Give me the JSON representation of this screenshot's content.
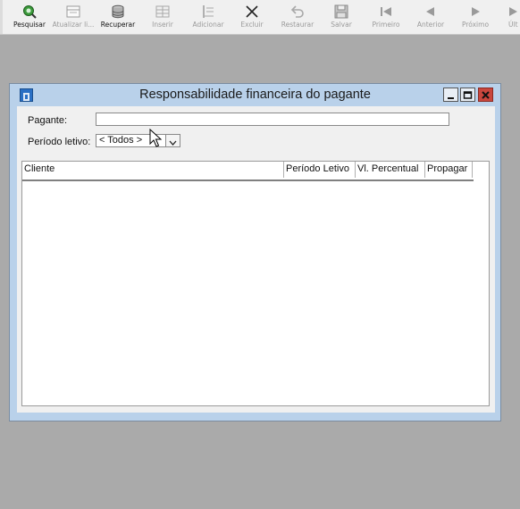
{
  "toolbar": {
    "buttons": [
      {
        "label": "Pesquisar",
        "icon": "search-icon",
        "enabled": true
      },
      {
        "label": "Atualizar li...",
        "icon": "refresh-list-icon",
        "enabled": false
      },
      {
        "label": "Recuperar",
        "icon": "database-icon",
        "enabled": true
      },
      {
        "label": "Inserir",
        "icon": "insert-icon",
        "enabled": false
      },
      {
        "label": "Adicionar",
        "icon": "add-icon",
        "enabled": false
      },
      {
        "label": "Excluir",
        "icon": "delete-icon",
        "enabled": false
      },
      {
        "label": "Restaurar",
        "icon": "undo-icon",
        "enabled": false
      },
      {
        "label": "Salvar",
        "icon": "save-icon",
        "enabled": false
      },
      {
        "label": "Primeiro",
        "icon": "first-record-icon",
        "enabled": false
      },
      {
        "label": "Anterior",
        "icon": "previous-record-icon",
        "enabled": false
      },
      {
        "label": "Próximo",
        "icon": "next-record-icon",
        "enabled": false
      },
      {
        "label": "Últ",
        "icon": "last-record-icon",
        "enabled": false
      }
    ]
  },
  "window": {
    "title": "Responsabilidade financeira do pagante",
    "pagante_label": "Pagante:",
    "pagante_value": "",
    "periodo_label": "Período letivo:",
    "periodo_value": "< Todos >",
    "grid": {
      "columns": [
        "Cliente",
        "Período Letivo",
        "Vl. Percentual",
        "Propagar"
      ],
      "rows": []
    }
  },
  "colors": {
    "desktop": "#aaaaaa",
    "window_frame": "#b9d1ea",
    "close_button": "#c9463d"
  }
}
